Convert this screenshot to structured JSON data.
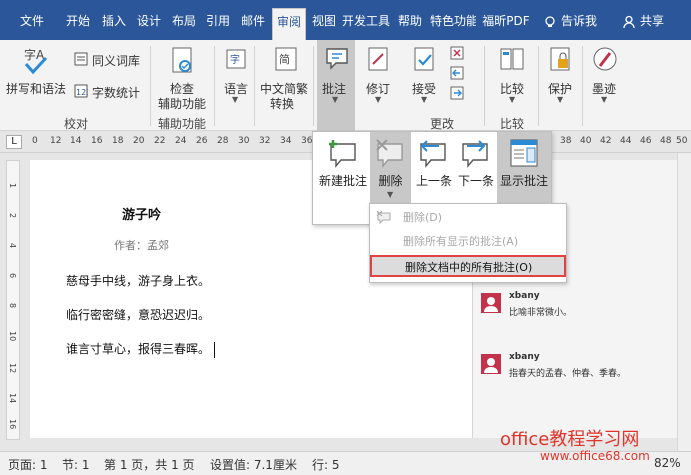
{
  "tabs": [
    {
      "label": "文件"
    },
    {
      "label": "开始"
    },
    {
      "label": "插入"
    },
    {
      "label": "设计"
    },
    {
      "label": "布局"
    },
    {
      "label": "引用"
    },
    {
      "label": "邮件"
    },
    {
      "label": "审阅"
    },
    {
      "label": "视图"
    },
    {
      "label": "开发工具"
    },
    {
      "label": "帮助"
    },
    {
      "label": "特色功能"
    },
    {
      "label": "福昕PDF"
    }
  ],
  "tell_me": "告诉我",
  "share": "共享",
  "ribbon": {
    "spelling": "拼写和语法",
    "thesaurus": "同义词库",
    "word_count": "字数统计",
    "check_line1": "检查",
    "check_line2": "辅助功能",
    "language": "语言",
    "chinese_conv_line1": "中文简繁",
    "chinese_conv_line2": "转换",
    "comments": "批注",
    "track": "修订",
    "accept": "接受",
    "compare": "比较",
    "protect": "保护",
    "ink": "墨迹",
    "group_proofing": "校对",
    "group_accessibility": "辅助功能",
    "group_changes": "更改",
    "group_compare": "比较"
  },
  "comment_panel": {
    "new": "新建批注",
    "delete": "删除",
    "prev": "上一条",
    "next": "下一条",
    "show": "显示批注"
  },
  "delete_menu": {
    "item1": "删除(D)",
    "item2": "删除所有显示的批注(A)",
    "item3": "删除文档中的所有批注(O)"
  },
  "ruler": {
    "corner": "L",
    "ticks": [
      "0",
      "12",
      "14",
      "16",
      "18",
      "20",
      "22",
      "24",
      "26",
      "28",
      "30",
      "32",
      "34",
      "36",
      "38",
      "40",
      "42",
      "44",
      "46",
      "48",
      "50"
    ],
    "vticks": [
      "1",
      "2",
      "4",
      "6",
      "8",
      "10",
      "12",
      "14",
      "16"
    ]
  },
  "document": {
    "title": "游子吟",
    "author": "作者：孟郊",
    "lines": [
      "慈母手中线，游子身上衣。",
      "临行密密缝，意恐迟迟归。",
      "谁言寸草心，报得三春晖。"
    ]
  },
  "comments": [
    {
      "author": "xbany",
      "text": "比喻非常微小。"
    },
    {
      "author": "xbany",
      "text": "指春天的孟春、仲春、季春。"
    }
  ],
  "status": {
    "page": "页面: 1",
    "section": "节: 1",
    "pages": "第 1 页，共 1 页",
    "setting": "设置值: 7.1厘米",
    "row": "行: 5",
    "zoom": "82%"
  },
  "watermark": {
    "line1": "office教程学习网",
    "line2": "www.office68.com"
  },
  "colors": {
    "accent": "#2b579a",
    "comment_avatar": "#c4314b",
    "highlight_box": "#e04343"
  }
}
